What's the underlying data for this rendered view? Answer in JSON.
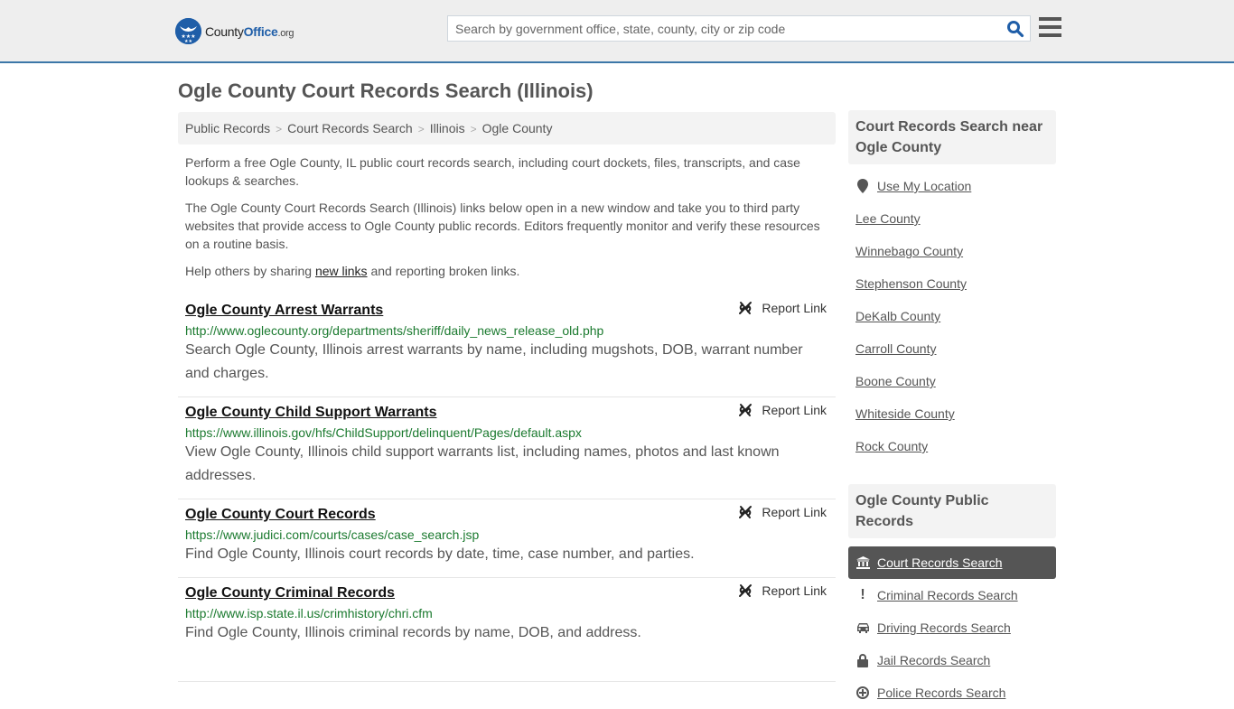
{
  "header": {
    "logo": {
      "brand_prefix": "County",
      "brand_main": "Office",
      "brand_suffix": ".org"
    },
    "search": {
      "placeholder": "Search by government office, state, county, city or zip code",
      "value": ""
    },
    "icons": {
      "search": "search-icon",
      "menu": "hamburger-menu-icon"
    }
  },
  "page": {
    "title": "Ogle County Court Records Search (Illinois)"
  },
  "breadcrumb": [
    {
      "label": "Public Records"
    },
    {
      "label": "Court Records Search"
    },
    {
      "label": "Illinois"
    },
    {
      "label": "Ogle County"
    }
  ],
  "breadcrumb_separator": ">",
  "intro": {
    "p1": "Perform a free Ogle County, IL public court records search, including court dockets, files, transcripts, and case lookups & searches.",
    "p2": "The Ogle County Court Records Search (Illinois) links below open in a new window and take you to third party websites that provide access to Ogle County public records. Editors frequently monitor and verify these resources on a routine basis.",
    "p3_before": "Help others by sharing ",
    "p3_link": "new links",
    "p3_after": " and reporting broken links."
  },
  "results": [
    {
      "title": "Ogle County Arrest Warrants",
      "url": "http://www.oglecounty.org/departments/sheriff/daily_news_release_old.php",
      "description": "Search Ogle County, Illinois arrest warrants by name, including mugshots, DOB, warrant number and charges.",
      "report_label": "Report Link"
    },
    {
      "title": "Ogle County Child Support Warrants",
      "url": "https://www.illinois.gov/hfs/ChildSupport/delinquent/Pages/default.aspx",
      "description": "View Ogle County, Illinois child support warrants list, including names, photos and last known addresses.",
      "report_label": "Report Link"
    },
    {
      "title": "Ogle County Court Records",
      "url": "https://www.judici.com/courts/cases/case_search.jsp",
      "description": "Find Ogle County, Illinois court records by date, time, case number, and parties.",
      "report_label": "Report Link"
    },
    {
      "title": "Ogle County Criminal Records",
      "url": "http://www.isp.state.il.us/crimhistory/chri.cfm",
      "description": "Find Ogle County, Illinois criminal records by name, DOB, and address.",
      "report_label": "Report Link"
    }
  ],
  "sidebar": {
    "nearby": {
      "heading": "Court Records Search near Ogle County",
      "use_location": "Use My Location",
      "counties": [
        "Lee County",
        "Winnebago County",
        "Stephenson County",
        "DeKalb County",
        "Carroll County",
        "Boone County",
        "Whiteside County",
        "Rock County"
      ]
    },
    "public_records": {
      "heading": "Ogle County Public Records",
      "items": [
        {
          "label": "Court Records Search",
          "icon": "courthouse-icon",
          "active": true
        },
        {
          "label": "Criminal Records Search",
          "icon": "exclamation-icon",
          "active": false
        },
        {
          "label": "Driving Records Search",
          "icon": "car-icon",
          "active": false
        },
        {
          "label": "Jail Records Search",
          "icon": "lock-icon",
          "active": false
        },
        {
          "label": "Police Records Search",
          "icon": "police-badge-icon",
          "active": false
        }
      ]
    }
  },
  "colors": {
    "brand_blue": "#1f5ea8",
    "header_border": "#3c77a8",
    "url_green": "#1b7a2f",
    "active_bg": "#555555"
  }
}
